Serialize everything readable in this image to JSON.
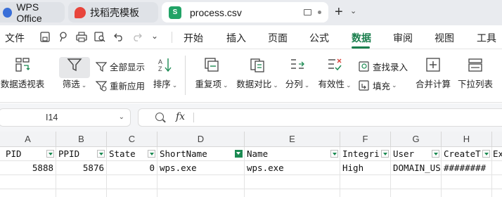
{
  "tabs": [
    {
      "label": "WPS Office",
      "icon": "wps-logo-icon"
    },
    {
      "label": "找稻壳模板",
      "icon": "docer-icon"
    },
    {
      "label": "process.csv",
      "icon": "spreadsheet-icon",
      "icon_letter": "S"
    }
  ],
  "menu": {
    "file": "文件",
    "items": [
      "开始",
      "插入",
      "页面",
      "公式",
      "数据",
      "审阅",
      "视图",
      "工具"
    ],
    "active": "数据"
  },
  "ribbon": {
    "pivot": "数据透视表",
    "filter": "筛选",
    "show_all": "全部显示",
    "reapply": "重新应用",
    "sort": "排序",
    "duplicates": "重复项",
    "compare": "数据对比",
    "split": "分列",
    "validity": "有效性",
    "lookup_entry": "查找录入",
    "fill": "填充",
    "consolidate": "合并计算",
    "dropdown": "下拉列表"
  },
  "formula_bar": {
    "cell_ref": "I14",
    "fx": "fx",
    "value": ""
  },
  "grid": {
    "columns": [
      "A",
      "B",
      "C",
      "D",
      "E",
      "F",
      "G",
      "H"
    ],
    "header_row": [
      "PID",
      "PPID",
      "State",
      "ShortName",
      "Name",
      "Integri",
      "User",
      "CreateT",
      "Ex"
    ],
    "rows": [
      [
        "5888",
        "5876",
        "0",
        "wps.exe",
        "wps.exe",
        "High",
        "DOMAIN_US",
        "########"
      ]
    ],
    "active_filter_column": "ShortName"
  },
  "colors": {
    "accent": "#1b7f4e",
    "csv_icon": "#21a366"
  }
}
